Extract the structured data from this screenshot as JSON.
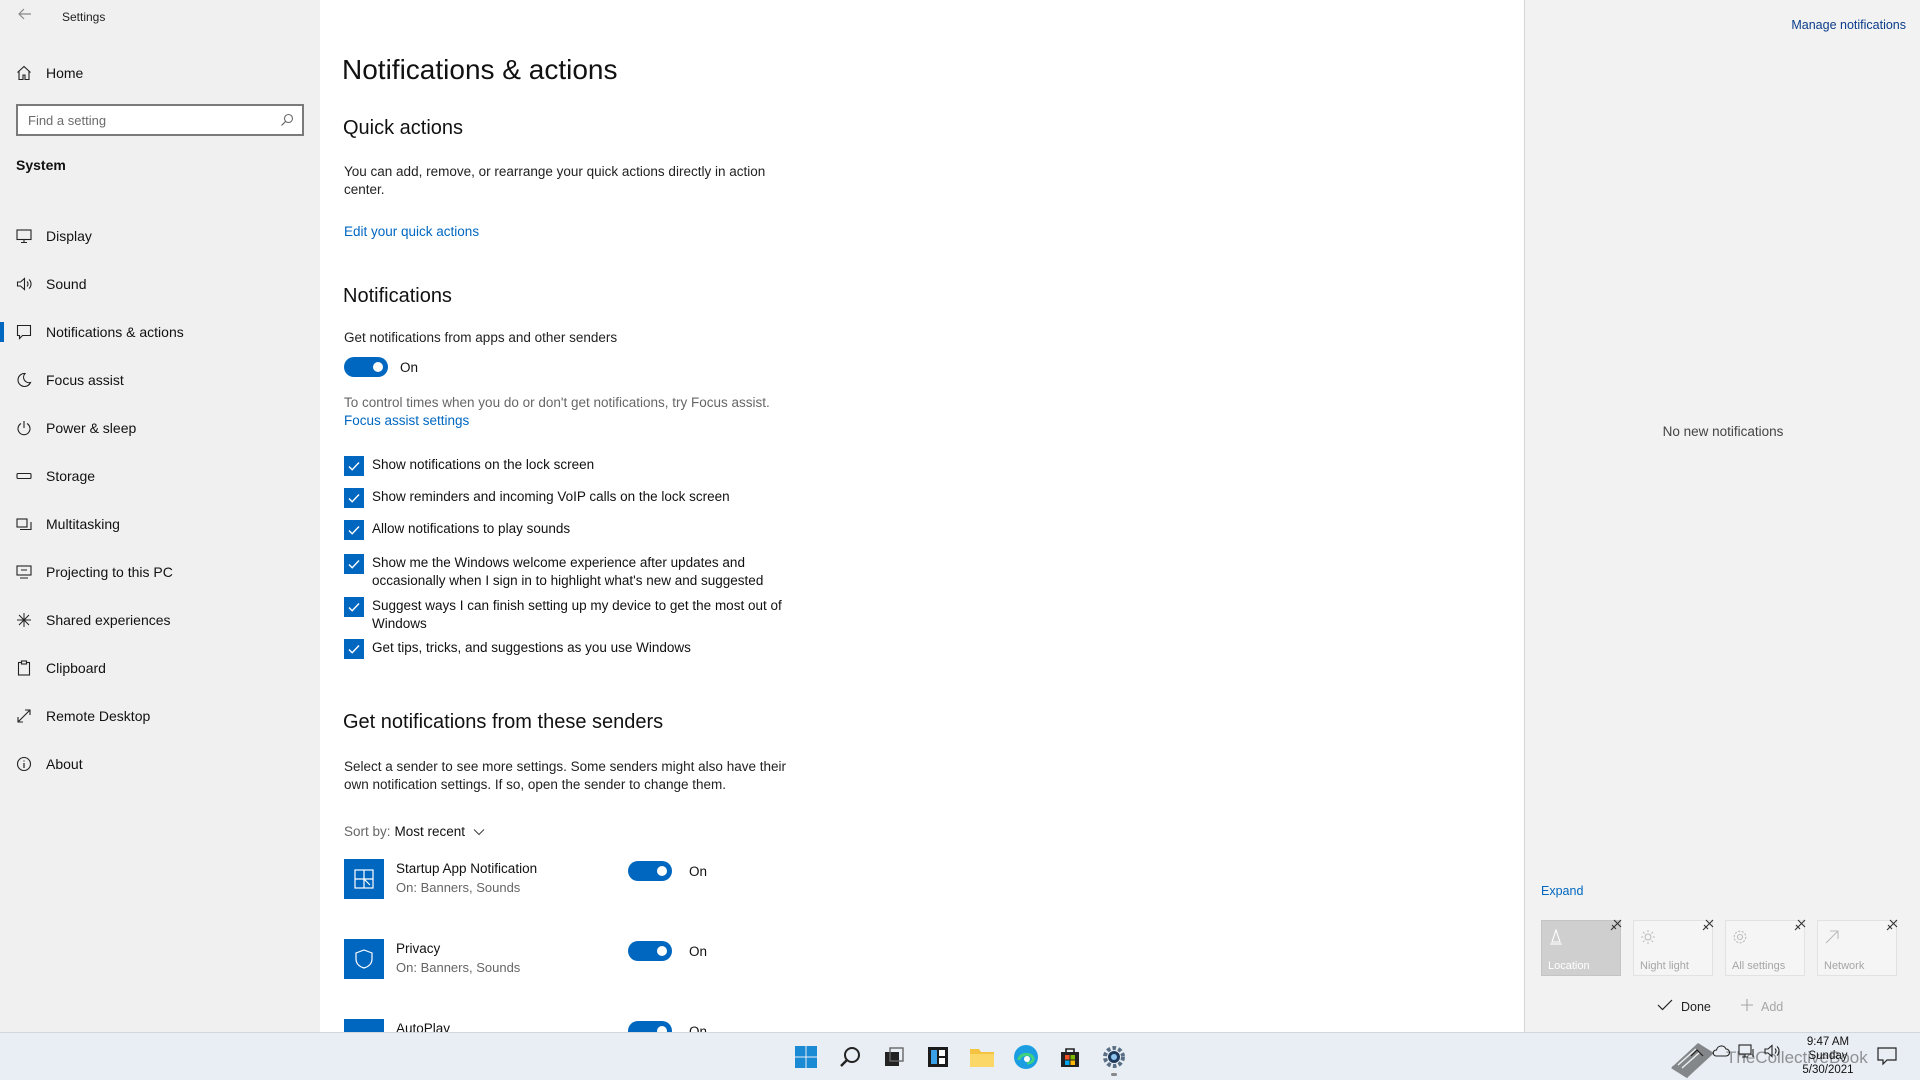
{
  "window": {
    "title": "Settings"
  },
  "sidebar": {
    "home_label": "Home",
    "search_placeholder": "Find a setting",
    "section_title": "System",
    "items": [
      {
        "label": "Display",
        "icon": "monitor-icon"
      },
      {
        "label": "Sound",
        "icon": "speaker-icon"
      },
      {
        "label": "Notifications & actions",
        "icon": "message-icon",
        "active": true
      },
      {
        "label": "Focus assist",
        "icon": "moon-icon"
      },
      {
        "label": "Power & sleep",
        "icon": "power-icon"
      },
      {
        "label": "Storage",
        "icon": "storage-icon"
      },
      {
        "label": "Multitasking",
        "icon": "multitasking-icon"
      },
      {
        "label": "Projecting to this PC",
        "icon": "projector-icon"
      },
      {
        "label": "Shared experiences",
        "icon": "shared-icon"
      },
      {
        "label": "Clipboard",
        "icon": "clipboard-icon"
      },
      {
        "label": "Remote Desktop",
        "icon": "remote-icon"
      },
      {
        "label": "About",
        "icon": "info-icon"
      }
    ]
  },
  "main": {
    "page_title": "Notifications & actions",
    "quick_actions": {
      "heading": "Quick actions",
      "description": "You can add, remove, or rearrange your quick actions directly in action center.",
      "link": "Edit your quick actions"
    },
    "notifications": {
      "heading": "Notifications",
      "get_label": "Get notifications from apps and other senders",
      "toggle_state": "On",
      "focus_text": "To control times when you do or don't get notifications, try Focus assist.",
      "focus_link": "Focus assist settings",
      "checkboxes": [
        {
          "label": "Show notifications on the lock screen",
          "checked": true
        },
        {
          "label": "Show reminders and incoming VoIP calls on the lock screen",
          "checked": true
        },
        {
          "label": "Allow notifications to play sounds",
          "checked": true
        },
        {
          "label": "Show me the Windows welcome experience after updates and occasionally when I sign in to highlight what's new and suggested",
          "checked": true
        },
        {
          "label": "Suggest ways I can finish setting up my device to get the most out of Windows",
          "checked": true
        },
        {
          "label": "Get tips, tricks, and suggestions as you use Windows",
          "checked": true
        }
      ]
    },
    "senders": {
      "heading": "Get notifications from these senders",
      "description": "Select a sender to see more settings. Some senders might also have their own notification settings. If so, open the sender to change them.",
      "sort_label": "Sort by:",
      "sort_value": "Most recent",
      "items": [
        {
          "name": "Startup App Notification",
          "sub": "On: Banners, Sounds",
          "state": "On"
        },
        {
          "name": "Privacy",
          "sub": "On: Banners, Sounds",
          "state": "On"
        },
        {
          "name": "AutoPlay",
          "sub": "",
          "state": "On"
        }
      ]
    }
  },
  "action_center": {
    "manage_link": "Manage notifications",
    "empty_text": "No new notifications",
    "expand_link": "Expand",
    "tiles": [
      {
        "label": "Location",
        "on": true
      },
      {
        "label": "Night light",
        "on": false
      },
      {
        "label": "All settings",
        "on": false
      },
      {
        "label": "Network",
        "on": false
      }
    ],
    "done_label": "Done",
    "add_label": "Add"
  },
  "taskbar": {
    "clock_time": "9:47 AM",
    "clock_day": "Sunday",
    "clock_date": "5/30/2021",
    "watermark": "TheCollectiveBook"
  },
  "colors": {
    "accent": "#0067c0",
    "sidebar_bg": "#f0f0f0",
    "action_center_bg": "#f2f2f2"
  }
}
